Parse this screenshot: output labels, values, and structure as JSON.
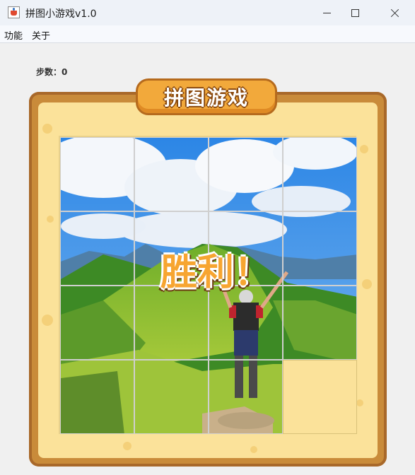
{
  "window": {
    "title": "拼图小游戏v1.0",
    "icon": "java-cup-icon"
  },
  "menu": {
    "items": [
      {
        "label": "功能"
      },
      {
        "label": "关于"
      }
    ]
  },
  "game": {
    "steps_label": "步数：0",
    "banner": "拼图游戏",
    "victory": "胜利！",
    "grid": {
      "rows": 4,
      "cols": 4,
      "blank_tile": 16
    }
  },
  "colors": {
    "frame": "#c98b3a",
    "frame_inner": "#fbe29a",
    "banner": "#f2a93b",
    "victory_text": "#f7a531"
  }
}
